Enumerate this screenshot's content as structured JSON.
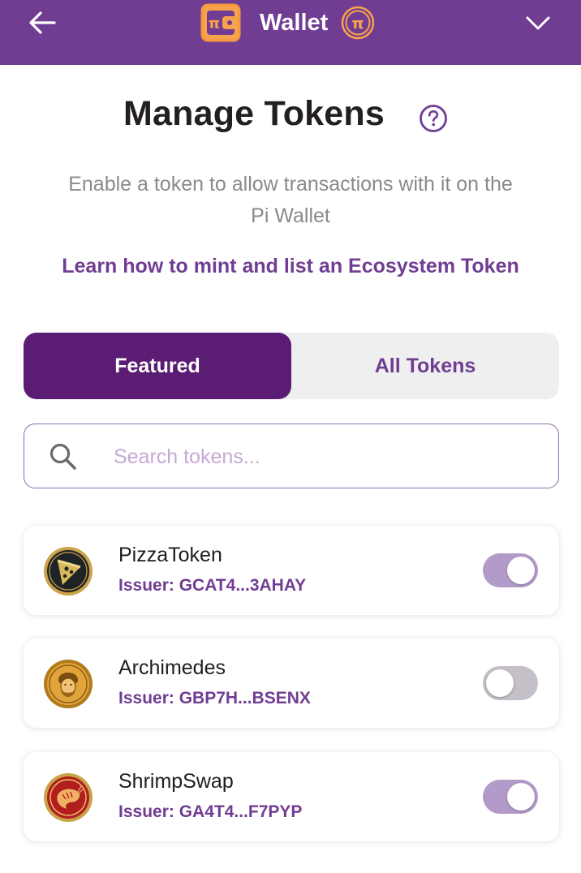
{
  "header": {
    "title": "Wallet",
    "back_icon": "arrow-left-icon",
    "brand_icon": "pi-wallet-icon",
    "coin_icon": "pi-coin-icon",
    "menu_icon": "chevron-down-icon",
    "background_color": "#703d92"
  },
  "page": {
    "title": "Manage Tokens",
    "help_icon": "question-circle-icon",
    "subtitle": "Enable a token to allow transactions with it on the Pi Wallet",
    "learn_link": "Learn how to mint and list an Ecosystem Token"
  },
  "tabs": {
    "featured": "Featured",
    "all_tokens": "All Tokens",
    "selected": "Featured"
  },
  "search": {
    "placeholder": "Search tokens...",
    "value": ""
  },
  "tokens": [
    {
      "name": "PizzaToken",
      "issuer": "Issuer: GCAT4...3AHAY",
      "enabled": true,
      "icon": "pizza-token-icon"
    },
    {
      "name": "Archimedes",
      "issuer": "Issuer: GBP7H...BSENX",
      "enabled": false,
      "icon": "archimedes-token-icon"
    },
    {
      "name": "ShrimpSwap",
      "issuer": "Issuer: GA4T4...F7PYP",
      "enabled": true,
      "icon": "shrimpswap-token-icon"
    }
  ],
  "colors": {
    "brand_purple": "#703d92",
    "tab_active": "#5b1c73",
    "toggle_on": "#b39bc9",
    "toggle_off": "#c5bfc8"
  }
}
